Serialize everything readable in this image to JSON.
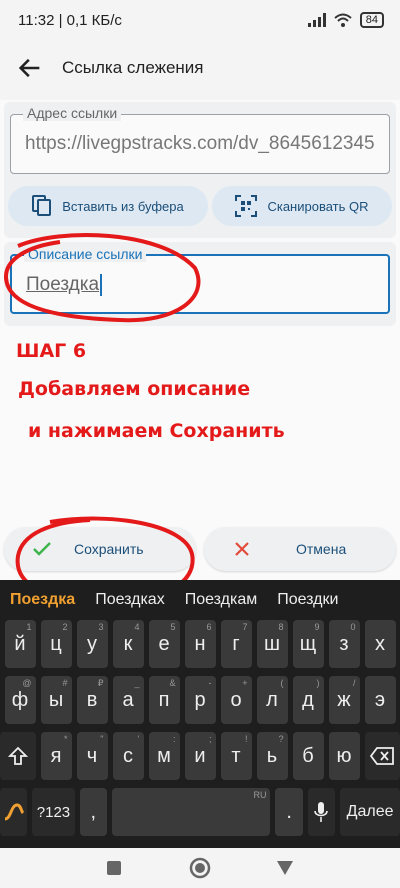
{
  "status_bar": {
    "text": "11:32 | 0,1 КБ/с",
    "battery": "84"
  },
  "app_bar": {
    "title": "Ссылка слежения"
  },
  "url_field": {
    "label": "Адрес ссылки",
    "value": "https://livegpstracks.com/dv_8645612345"
  },
  "buttons_top": {
    "paste": "Вставить из буфера",
    "scan": "Сканировать QR"
  },
  "desc_field": {
    "label": "Описание ссылки",
    "value": "Поездка"
  },
  "instructions": {
    "step": "ШАГ 6",
    "line1": "Добавляем описание",
    "line2": "и нажимаем Сохранить"
  },
  "actions": {
    "save": "Сохранить",
    "cancel": "Отмена"
  },
  "keyboard": {
    "suggestions": [
      "Поездка",
      "Поездках",
      "Поездкам",
      "Поездки"
    ],
    "row1": [
      "й",
      "ц",
      "у",
      "к",
      "е",
      "н",
      "г",
      "ш",
      "щ",
      "з",
      "х"
    ],
    "row1_hints": [
      "1",
      "2",
      "3",
      "4",
      "5",
      "6",
      "7",
      "8",
      "9",
      "0",
      ""
    ],
    "row2": [
      "ф",
      "ы",
      "в",
      "а",
      "п",
      "р",
      "о",
      "л",
      "д",
      "ж",
      "э"
    ],
    "row2_hints": [
      "@",
      "#",
      "₽",
      "_",
      "&",
      "-",
      "+",
      "(",
      ")",
      "/",
      ""
    ],
    "row3": [
      "я",
      "ч",
      "с",
      "м",
      "и",
      "т",
      "ь",
      "б",
      "ю"
    ],
    "row3_hints": [
      "*",
      "\"",
      "'",
      ":",
      ";",
      "!",
      "?",
      "",
      ""
    ],
    "symbols_label": "?123",
    "space_hint": "RU",
    "next_label": "Далее"
  },
  "colors": {
    "accent": "#1a73b8",
    "annotation": "#e41a1a",
    "suggest_active": "#f0a030"
  }
}
